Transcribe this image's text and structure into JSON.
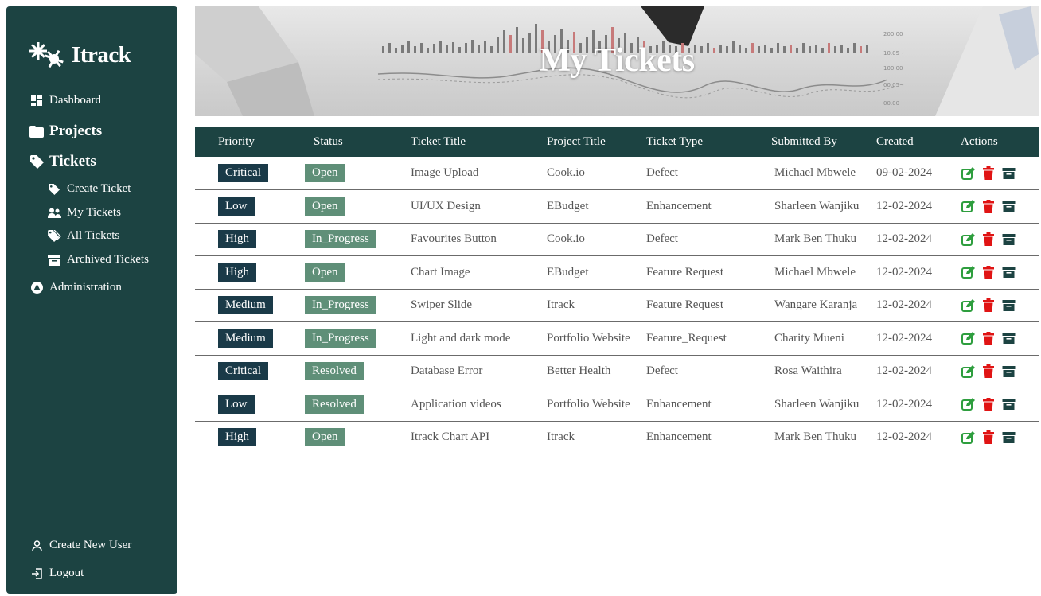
{
  "app": {
    "name": "Itrack"
  },
  "sidebar": {
    "items": [
      {
        "label": "Dashboard",
        "icon": "dashboard-icon"
      },
      {
        "label": "Projects",
        "icon": "folder-icon"
      },
      {
        "label": "Tickets",
        "icon": "tag-icon"
      },
      {
        "label": "Create Ticket",
        "icon": "tag-icon"
      },
      {
        "label": "My Tickets",
        "icon": "user-group-icon"
      },
      {
        "label": "All Tickets",
        "icon": "tags-icon"
      },
      {
        "label": "Archived Tickets",
        "icon": "archive-icon"
      },
      {
        "label": "Administration",
        "icon": "admin-icon"
      }
    ],
    "footer": [
      {
        "label": "Create New User",
        "icon": "user-icon"
      },
      {
        "label": "Logout",
        "icon": "logout-icon"
      }
    ]
  },
  "banner": {
    "title": "My Tickets"
  },
  "table": {
    "headers": [
      "Priority",
      "Status",
      "Ticket Title",
      "Project Title",
      "Ticket Type",
      "Submitted By",
      "Created",
      "Actions"
    ],
    "rows": [
      {
        "priority": "Critical",
        "status": "Open",
        "title": "Image Upload",
        "project": "Cook.io",
        "type": "Defect",
        "submitted_by": "Michael Mbwele",
        "created": "09-02-2024"
      },
      {
        "priority": "Low",
        "status": "Open",
        "title": "UI/UX Design",
        "project": "EBudget",
        "type": "Enhancement",
        "submitted_by": "Sharleen Wanjiku",
        "created": "12-02-2024"
      },
      {
        "priority": "High",
        "status": "In_Progress",
        "title": "Favourites Button",
        "project": "Cook.io",
        "type": "Defect",
        "submitted_by": "Mark Ben Thuku",
        "created": "12-02-2024"
      },
      {
        "priority": "High",
        "status": "Open",
        "title": "Chart Image",
        "project": "EBudget",
        "type": "Feature Request",
        "submitted_by": "Michael Mbwele",
        "created": "12-02-2024"
      },
      {
        "priority": "Medium",
        "status": "In_Progress",
        "title": "Swiper Slide",
        "project": "Itrack",
        "type": "Feature Request",
        "submitted_by": "Wangare Karanja",
        "created": "12-02-2024"
      },
      {
        "priority": "Medium",
        "status": "In_Progress",
        "title": "Light and dark mode",
        "project": "Portfolio Website",
        "type": "Feature_Request",
        "submitted_by": "Charity Mueni",
        "created": "12-02-2024"
      },
      {
        "priority": "Critical",
        "status": "Resolved",
        "title": "Database Error",
        "project": "Better Health",
        "type": "Defect",
        "submitted_by": "Rosa Waithira",
        "created": "12-02-2024"
      },
      {
        "priority": "Low",
        "status": "Resolved",
        "title": "Application videos",
        "project": "Portfolio Website",
        "type": "Enhancement",
        "submitted_by": "Sharleen Wanjiku",
        "created": "12-02-2024"
      },
      {
        "priority": "High",
        "status": "Open",
        "title": "Itrack Chart API",
        "project": "Itrack",
        "type": "Enhancement",
        "submitted_by": "Mark Ben Thuku",
        "created": "12-02-2024"
      }
    ],
    "action_icons": [
      "edit-icon",
      "trash-icon",
      "archive-icon"
    ]
  },
  "colors": {
    "sidebar_bg": "#1c4342",
    "priority_badge": "#1a3a48",
    "status_badge": "#5f8f78",
    "edit": "#2e9e3e",
    "delete": "#e01414",
    "archive": "#1c4342"
  }
}
